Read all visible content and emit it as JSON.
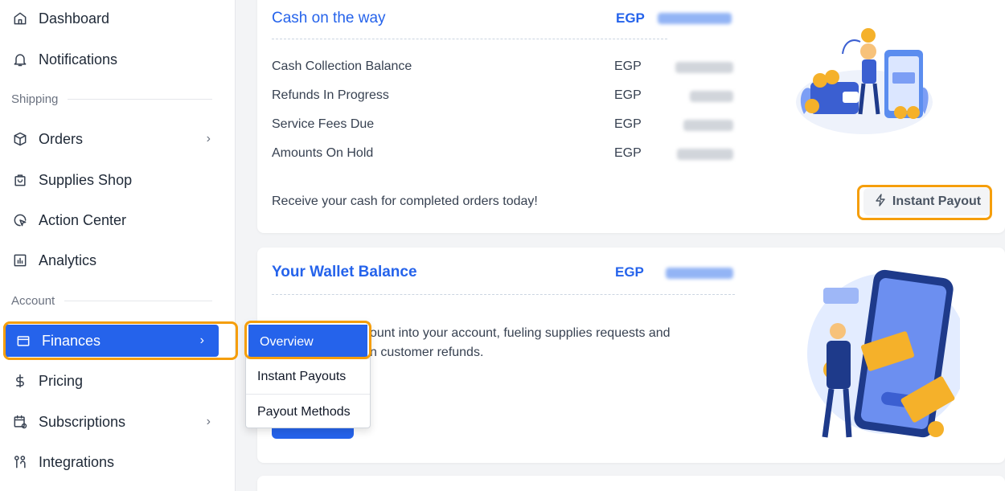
{
  "sidebar": {
    "items": [
      {
        "label": "Dashboard",
        "icon": "home-icon"
      },
      {
        "label": "Notifications",
        "icon": "bell-icon"
      },
      {
        "label": "Orders",
        "icon": "box-icon"
      },
      {
        "label": "Supplies Shop",
        "icon": "bag-icon"
      },
      {
        "label": "Action Center",
        "icon": "cursor-target-icon"
      },
      {
        "label": "Analytics",
        "icon": "chart-icon"
      },
      {
        "label": "Finances",
        "icon": "wallet-icon"
      },
      {
        "label": "Pricing",
        "icon": "dollar-icon"
      },
      {
        "label": "Subscriptions",
        "icon": "calendar-icon"
      },
      {
        "label": "Integrations",
        "icon": "integration-icon"
      }
    ],
    "sections": {
      "shipping": "Shipping",
      "account": "Account"
    },
    "chevron": "›"
  },
  "cash_card": {
    "title": "Cash on the way",
    "currency": "EGP",
    "rows": [
      {
        "label": "Cash Collection Balance",
        "currency": "EGP"
      },
      {
        "label": "Refunds In Progress",
        "currency": "EGP"
      },
      {
        "label": "Service Fees Due",
        "currency": "EGP"
      },
      {
        "label": "Amounts On Hold",
        "currency": "EGP"
      }
    ],
    "note": "Receive your cash for completed orders today!",
    "button": "Instant Payout"
  },
  "wallet_card": {
    "title": "Your Wallet Balance",
    "currency": "EGP",
    "text_line1": "ount into your account, fueling supplies requests and",
    "text_line2": "n customer refunds."
  },
  "dropdown": {
    "items": [
      "Overview",
      "Instant Payouts",
      "Payout Methods"
    ]
  },
  "colors": {
    "accent": "#2563eb",
    "highlight": "#f59e0b"
  }
}
